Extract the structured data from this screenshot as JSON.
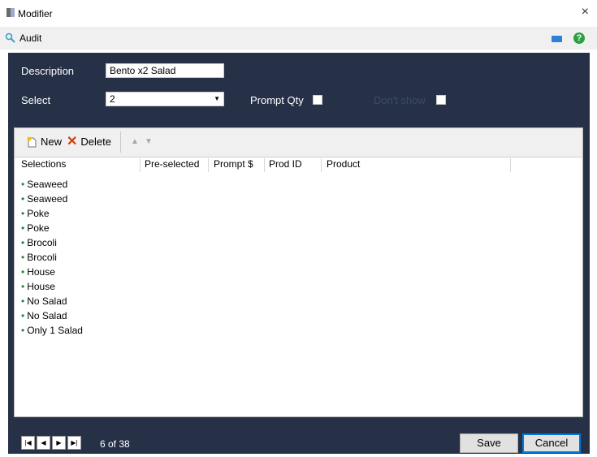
{
  "window": {
    "title": "Modifier",
    "close_glyph": "×"
  },
  "subbar": {
    "audit_label": "Audit"
  },
  "form": {
    "description_label": "Description",
    "description_value": "Bento x2 Salad",
    "select_label": "Select",
    "select_value": "2",
    "prompt_qty_label": "Prompt Qty",
    "dont_show_label": "Don't show"
  },
  "toolbar": {
    "new_label": "New",
    "delete_label": "Delete"
  },
  "grid": {
    "columns": [
      "Selections",
      "Pre-selected",
      "Prompt $",
      "Prod ID",
      "Product"
    ],
    "rows": [
      "Seaweed",
      "Seaweed",
      "Poke",
      "Poke",
      "Brocoli",
      "Brocoli",
      "House",
      "House",
      "No Salad",
      "No Salad",
      "Only 1 Salad"
    ]
  },
  "pager": {
    "count_text": "6 of 38"
  },
  "footer": {
    "save_label": "Save",
    "cancel_label": "Cancel"
  },
  "colors": {
    "panel": "#263147",
    "accent": "#0078d7",
    "help": "#2ea043",
    "delete": "#d83b01"
  }
}
